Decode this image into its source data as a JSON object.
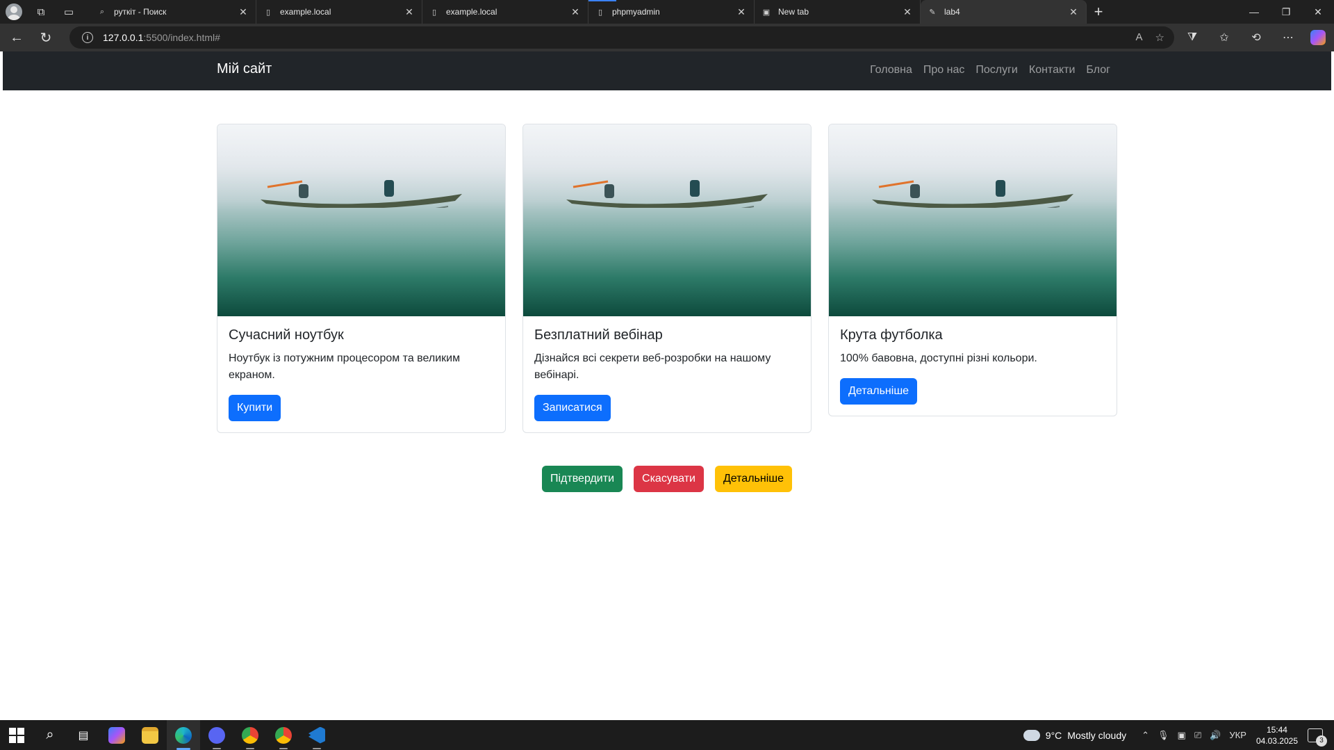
{
  "browser": {
    "tabs": [
      {
        "title": "руткіт - Поиск",
        "favicon": "search-icon"
      },
      {
        "title": "example.local",
        "favicon": "page-icon"
      },
      {
        "title": "example.local",
        "favicon": "page-icon"
      },
      {
        "title": "phpmyadmin",
        "favicon": "page-icon"
      },
      {
        "title": "New tab",
        "favicon": "newtab-icon"
      },
      {
        "title": "lab4",
        "favicon": "page-icon"
      }
    ],
    "url_host": "127.0.0.1",
    "url_rest": ":5500/index.html#"
  },
  "site": {
    "brand": "Мій сайт",
    "nav": [
      "Головна",
      "Про нас",
      "Послуги",
      "Контакти",
      "Блог"
    ],
    "cards": [
      {
        "title": "Сучасний ноутбук",
        "text": "Ноутбук із потужним процесором та великим екраном.",
        "button": "Купити"
      },
      {
        "title": "Безплатний вебінар",
        "text": "Дізнайся всі секрети веб-розробки на нашому вебінарі.",
        "button": "Записатися"
      },
      {
        "title": "Крута футболка",
        "text": "100% бавовна, доступні різні кольори.",
        "button": "Детальніше"
      }
    ],
    "actions": {
      "confirm": "Підтвердити",
      "cancel": "Скасувати",
      "details": "Детальніше"
    }
  },
  "taskbar": {
    "weather_temp": "9°C",
    "weather_desc": "Mostly cloudy",
    "language": "УКР",
    "time": "15:44",
    "date": "04.03.2025",
    "notifications": "3"
  },
  "colors": {
    "primary": "#0d6efd",
    "success": "#198754",
    "danger": "#dc3545",
    "warning": "#ffc107",
    "navbar": "#212529"
  }
}
